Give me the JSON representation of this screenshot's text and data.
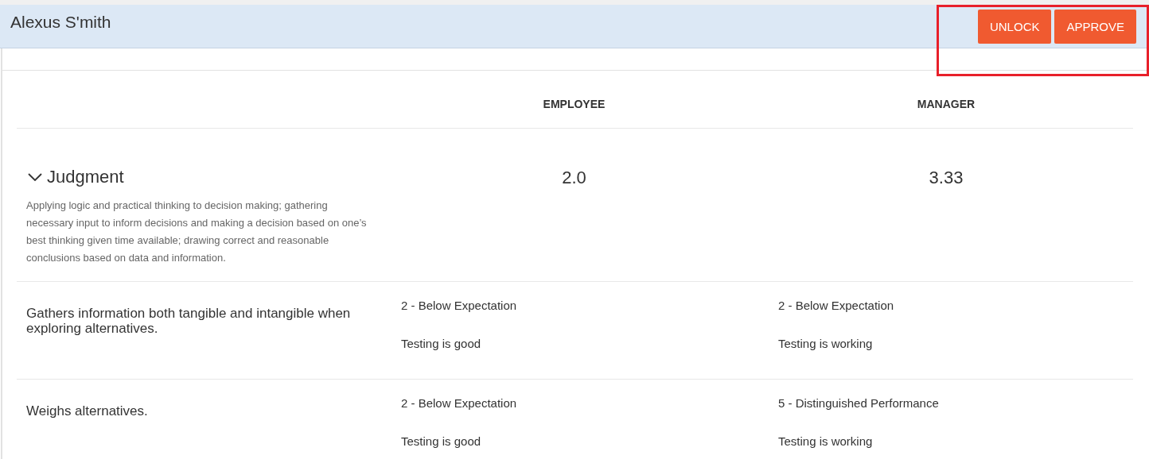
{
  "header": {
    "name": "Alexus S'mith",
    "buttons": [
      "UNLOCK",
      "APPROVE"
    ]
  },
  "columns": [
    "EMPLOYEE",
    "MANAGER"
  ],
  "competency": {
    "title": "Judgment",
    "expanded": true,
    "description": "Applying logic and practical thinking to decision making; gathering necessary input to inform decisions and making a decision based on one’s best thinking given time available; drawing correct and reasonable conclusions based on data and information.",
    "employee_score": "2.0",
    "manager_score": "3.33",
    "behaviors": [
      {
        "text": "Gathers information both tangible and intangible when exploring alternatives.",
        "employee": {
          "rating": "2 - Below Expectation",
          "comment": "Testing is good"
        },
        "manager": {
          "rating": "2 - Below Expectation",
          "comment": "Testing is working"
        }
      },
      {
        "text": "Weighs alternatives.",
        "employee": {
          "rating": "2 - Below Expectation",
          "comment": "Testing is good"
        },
        "manager": {
          "rating": "5 - Distinguished Performance",
          "comment": "Testing is working"
        }
      }
    ]
  }
}
